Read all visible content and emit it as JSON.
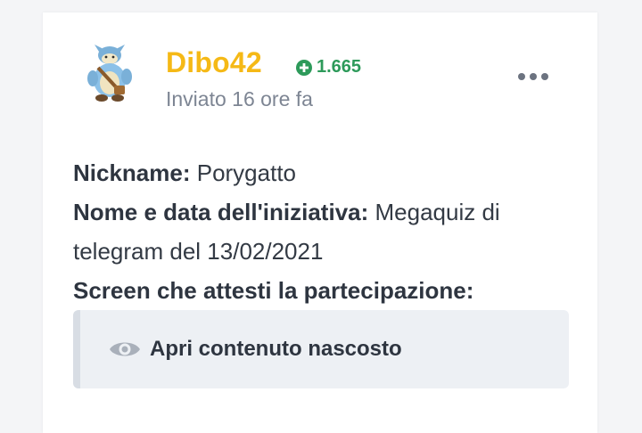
{
  "post": {
    "author": {
      "username": "Dibo42",
      "reputation": "1.665",
      "posted_time": "Inviato 16 ore fa",
      "avatar_icon": "pokemon-avatar"
    },
    "more_icon": "ellipsis-icon",
    "body": {
      "line1_label": "Nickname:",
      "line1_value": " Porygatto",
      "line2_label": "Nome e data dell'iniziativa:",
      "line2_value": " Megaquiz di telegram del 13/02/2021",
      "line3_label": "Screen che attesti la partecipazione:"
    },
    "hidden_content": {
      "label": "Apri contenuto nascosto",
      "icon": "eye-icon"
    }
  },
  "colors": {
    "username": "#f5b916",
    "reputation": "#2d9a5a",
    "muted": "#7d8593",
    "hidden_bg": "#edf0f4"
  }
}
